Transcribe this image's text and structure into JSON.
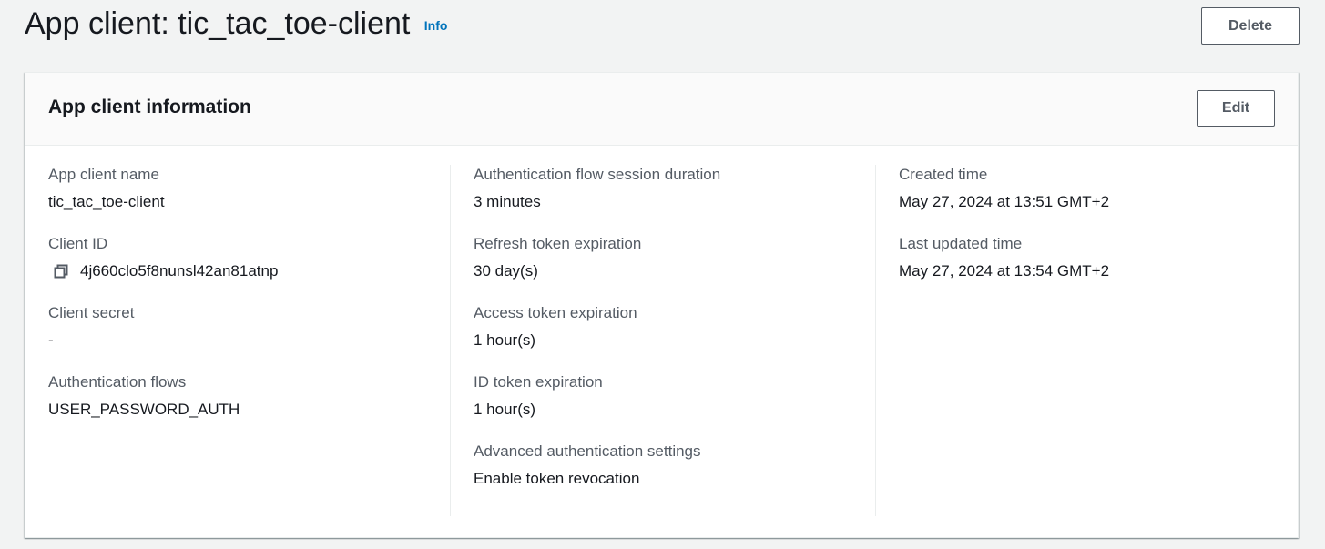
{
  "header": {
    "title": "App client: tic_tac_toe-client",
    "info_link": "Info",
    "delete_label": "Delete"
  },
  "card": {
    "title": "App client information",
    "edit_label": "Edit"
  },
  "columns": [
    [
      {
        "label": "App client name",
        "value": "tic_tac_toe-client"
      },
      {
        "label": "Client ID",
        "value": "4j660clo5f8nunsl42an81atnp",
        "icon": "copy-icon"
      },
      {
        "label": "Client secret",
        "value": "-"
      },
      {
        "label": "Authentication flows",
        "value": "USER_PASSWORD_AUTH"
      }
    ],
    [
      {
        "label": "Authentication flow session duration",
        "value": "3 minutes"
      },
      {
        "label": "Refresh token expiration",
        "value": "30 day(s)"
      },
      {
        "label": "Access token expiration",
        "value": "1 hour(s)"
      },
      {
        "label": "ID token expiration",
        "value": "1 hour(s)"
      },
      {
        "label": "Advanced authentication settings",
        "value": "Enable token revocation"
      }
    ],
    [
      {
        "label": "Created time",
        "value": "May 27, 2024 at 13:51 GMT+2"
      },
      {
        "label": "Last updated time",
        "value": "May 27, 2024 at 13:54 GMT+2"
      }
    ]
  ],
  "colors": {
    "link": "#0073bb",
    "label": "#545b64",
    "text": "#16191f",
    "background": "#f2f3f3"
  }
}
